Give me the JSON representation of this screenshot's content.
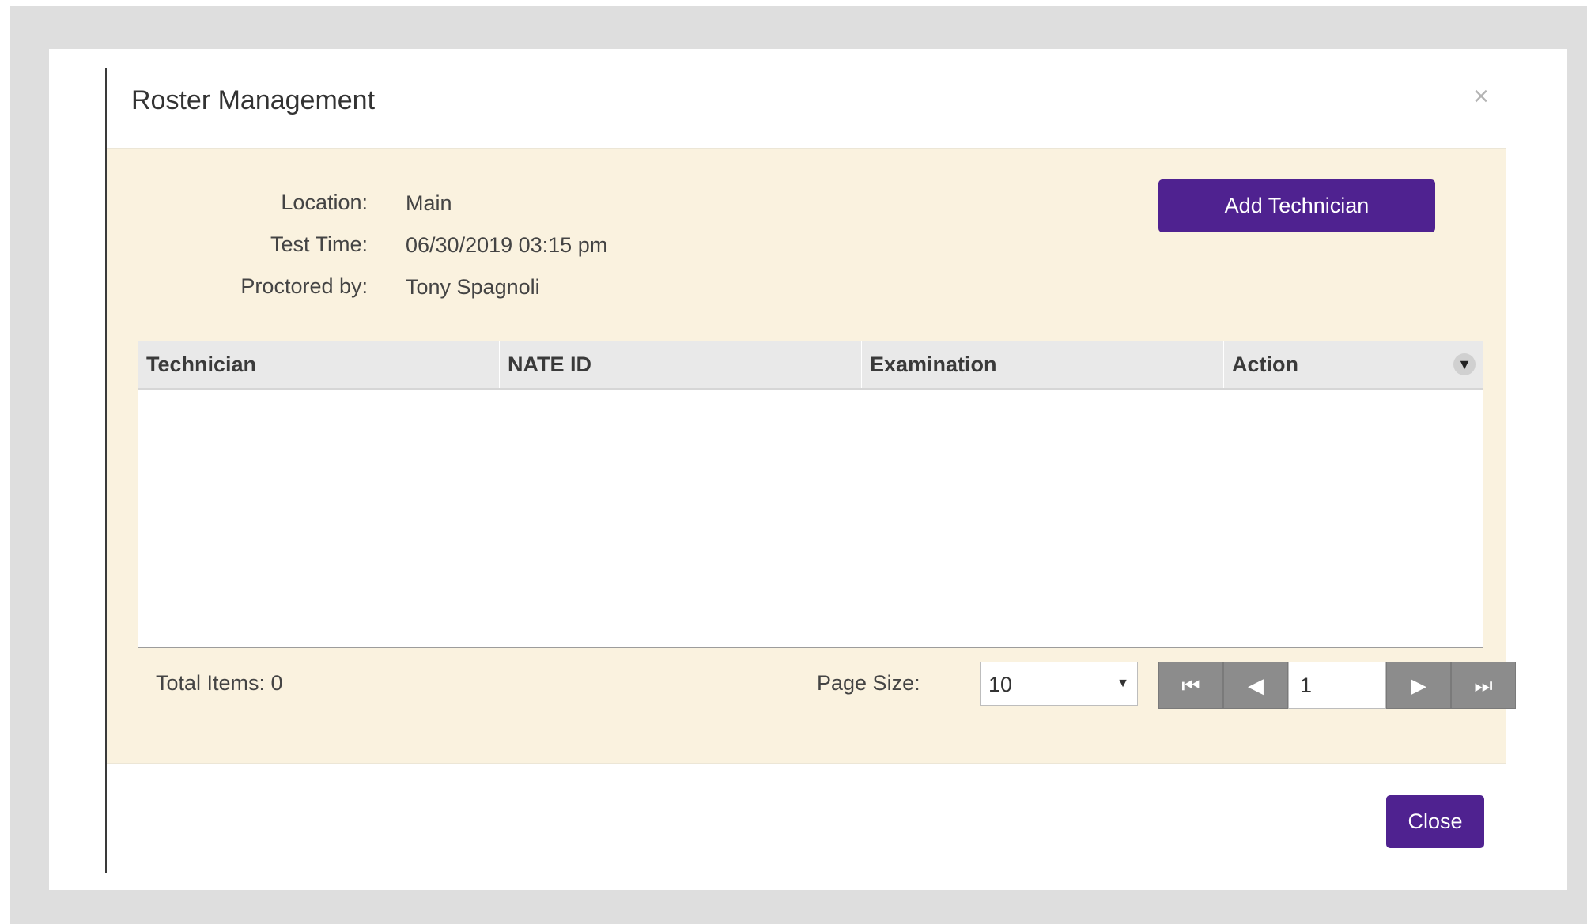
{
  "modal": {
    "title": "Roster Management",
    "close_icon_glyph": "×"
  },
  "details": {
    "location_label": "Location:",
    "location_value": "Main",
    "test_time_label": "Test Time:",
    "test_time_value": "06/30/2019 03:15 pm",
    "proctor_label": "Proctored by:",
    "proctor_value": "Tony Spagnoli"
  },
  "actions": {
    "add_technician_label": "Add Technician",
    "close_label": "Close"
  },
  "grid": {
    "columns": [
      "Technician",
      "NATE ID",
      "Examination",
      "Action"
    ],
    "column_menu_icon": "▼",
    "rows": []
  },
  "footer": {
    "total_items": "Total Items: 0",
    "page_size_label": "Page Size:",
    "page_size_value": "10",
    "page_size_arrow": "▼",
    "current_page": "1",
    "first_glyph": "⏮",
    "prev_glyph": "◀",
    "next_glyph": "▶",
    "last_glyph": "⏭"
  },
  "colors": {
    "accent": "#4f2290",
    "panel": "#faf2df",
    "backdrop": "#dedede"
  }
}
